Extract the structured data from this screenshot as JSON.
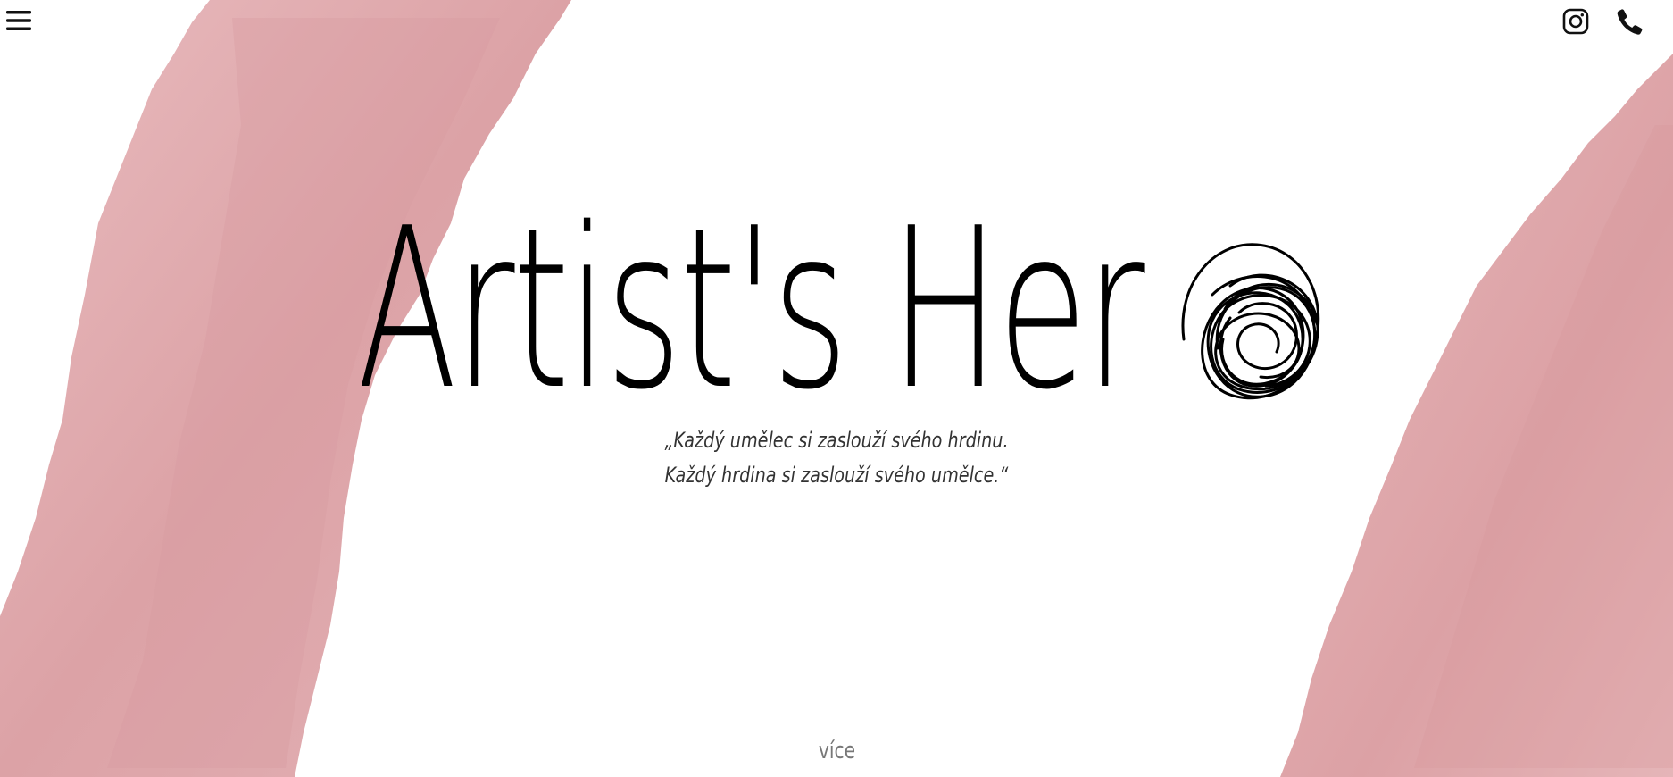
{
  "header": {
    "menu_icon": "hamburger-menu-icon",
    "instagram_icon": "instagram-icon",
    "phone_icon": "phone-icon"
  },
  "hero": {
    "title": "Artist's Her",
    "quote_line1": "„Každý umělec si zaslouží svého hrdinu.",
    "quote_line2": "Každý hrdina si zaslouží svého umělce.“"
  },
  "footer": {
    "more_label": "více"
  },
  "colors": {
    "brush_stroke": "#dfa7ac",
    "text": "#000000",
    "quote_text": "#333333",
    "more_text": "#777777"
  }
}
